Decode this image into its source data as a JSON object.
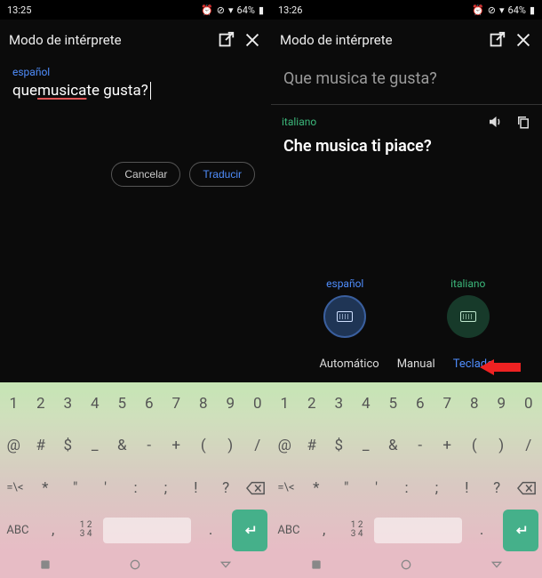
{
  "left": {
    "status": {
      "time": "13:25",
      "battery": "64%"
    },
    "appbar": {
      "title": "Modo de intérprete"
    },
    "src_lang": "español",
    "input": {
      "pre": "que ",
      "flag": "musica",
      "post": " te gusta?"
    },
    "buttons": {
      "cancel": "Cancelar",
      "translate": "Traducir"
    }
  },
  "right": {
    "status": {
      "time": "13:26",
      "battery": "64%"
    },
    "appbar": {
      "title": "Modo de intérprete"
    },
    "src_text": "Que musica te gusta?",
    "tgt_lang": "italiano",
    "tgt_text": "Che musica ti piace?",
    "switch": {
      "left": "español",
      "right": "italiano"
    },
    "modes": {
      "auto": "Automático",
      "manual": "Manual",
      "keyboard": "Teclado"
    }
  },
  "keyboard": {
    "row1": [
      "1",
      "2",
      "3",
      "4",
      "5",
      "6",
      "7",
      "8",
      "9",
      "0"
    ],
    "row2": [
      "@",
      "#",
      "$",
      "_",
      "&",
      "-",
      "+",
      "(",
      ")",
      "/"
    ],
    "row3_lead": "=\\<",
    "row3": [
      "*",
      "\"",
      "'",
      ":",
      ";",
      "!",
      "?"
    ],
    "row4": {
      "abc": "ABC",
      "comma": ",",
      "nums": "1 2\n3 4",
      "dot": "."
    }
  }
}
